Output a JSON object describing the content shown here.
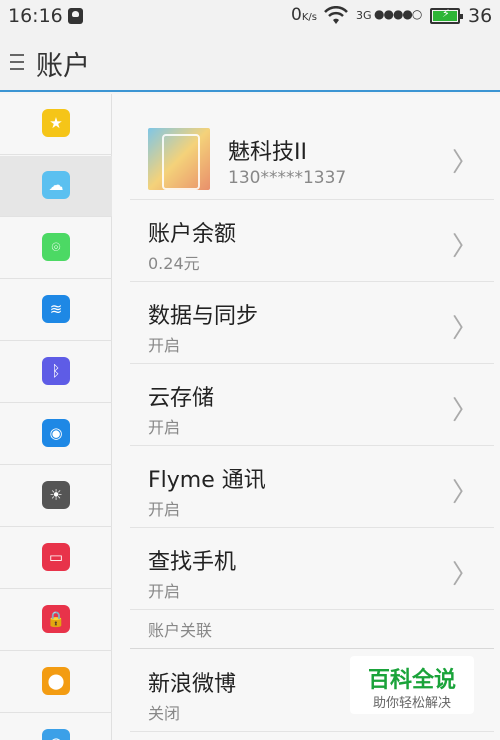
{
  "status_bar": {
    "time": "16:16",
    "net_speed": "0",
    "net_speed_unit": "K/s",
    "network": "3G",
    "signal_dots": "●●●●○",
    "battery_level": "36"
  },
  "header": {
    "title": "账户"
  },
  "sidebar": {
    "items": [
      {
        "icon": "star-icon",
        "color": "#f5c518",
        "glyph": "★"
      },
      {
        "icon": "cloud-icon",
        "color": "#5bc0f0",
        "glyph": "☁"
      },
      {
        "icon": "hotspot-icon",
        "color": "#4cd964",
        "glyph": "⌾"
      },
      {
        "icon": "wifi-icon",
        "color": "#1e88e5",
        "glyph": "≋"
      },
      {
        "icon": "bluetooth-icon",
        "color": "#5e5ce6",
        "glyph": "ᛒ"
      },
      {
        "icon": "broadcast-icon",
        "color": "#1e88e5",
        "glyph": "◉"
      },
      {
        "icon": "brightness-icon",
        "color": "#555555",
        "glyph": "☀"
      },
      {
        "icon": "toggle-icon",
        "color": "#e8334a",
        "glyph": "▭"
      },
      {
        "icon": "lock-icon",
        "color": "#e8334a",
        "glyph": "🔒"
      },
      {
        "icon": "location-icon",
        "color": "#f39c12",
        "glyph": "⬤"
      },
      {
        "icon": "globe-icon",
        "color": "#3ba0e8",
        "glyph": "◍"
      }
    ],
    "active_index": 1
  },
  "account": {
    "name": "魅科技II",
    "phone": "130*****1337"
  },
  "rows": [
    {
      "label": "账户余额",
      "sub": "0.24元"
    },
    {
      "label": "数据与同步",
      "sub": "开启"
    },
    {
      "label": "云存储",
      "sub": "开启"
    },
    {
      "label": "Flyme 通讯",
      "sub": "开启"
    },
    {
      "label": "查找手机",
      "sub": "开启"
    }
  ],
  "linked_section": {
    "header": "账户关联",
    "rows": [
      {
        "label": "新浪微博",
        "sub": "关闭"
      }
    ]
  },
  "watermark": {
    "title": "百科全说",
    "subtitle": "助你轻松解决"
  },
  "chevron": "〉"
}
